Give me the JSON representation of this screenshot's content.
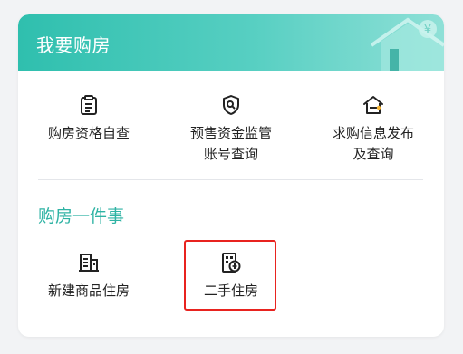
{
  "header": {
    "title": "我要购房"
  },
  "buy_items": [
    {
      "label_lines": [
        "购房资格自查"
      ],
      "icon": "clipboard-list-icon"
    },
    {
      "label_lines": [
        "预售资金监管",
        "账号查询"
      ],
      "icon": "shield-search-icon"
    },
    {
      "label_lines": [
        "求购信息发布",
        "及查询"
      ],
      "icon": "house-key-icon"
    }
  ],
  "section": {
    "title": "购房一件事"
  },
  "service_items": [
    {
      "label_lines": [
        "新建商品住房"
      ],
      "icon": "building-icon"
    },
    {
      "label_lines": [
        "二手住房"
      ],
      "icon": "second-hand-house-icon"
    }
  ],
  "colors": {
    "header_start": "#2fbfae",
    "header_end": "#8fe0d7",
    "section_title": "#2fb3a4",
    "highlight_border": "#e8231f",
    "icon_stroke": "#222222"
  }
}
